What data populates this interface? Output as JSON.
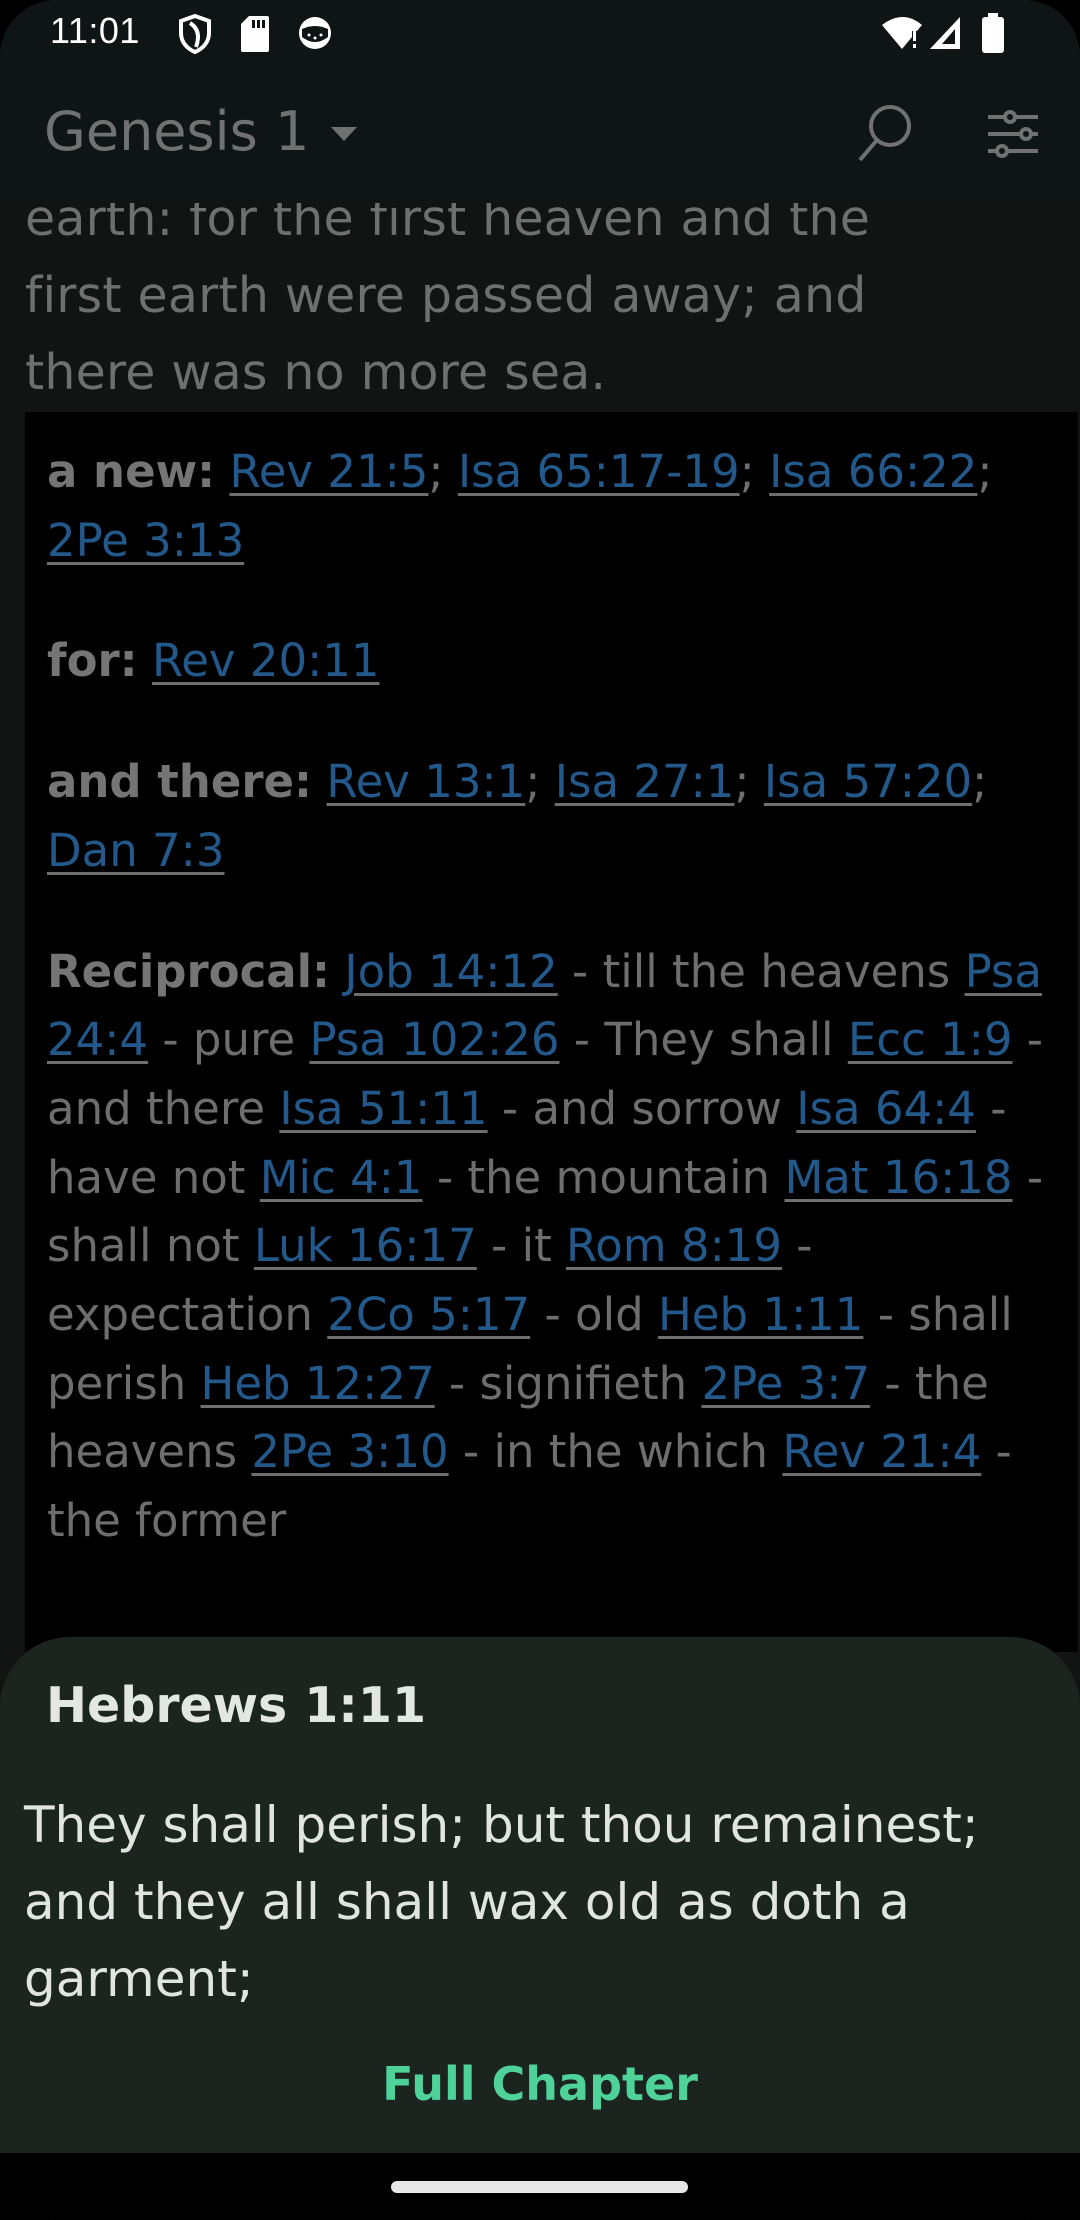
{
  "status_bar": {
    "time": "11:01",
    "left_icons": [
      "shield-icon",
      "sd-card-icon",
      "app-notification-icon"
    ],
    "right_icons": [
      "wifi-alert-icon",
      "cell-signal-icon",
      "battery-icon"
    ]
  },
  "app_bar": {
    "title": "Genesis 1",
    "actions": [
      "search-icon",
      "settings-sliders-icon"
    ]
  },
  "verse_fragment": {
    "lines": [
      "earth: for the first heaven and the",
      "first earth were passed away; and",
      "there was no more sea."
    ]
  },
  "cross_references": [
    {
      "label": "a new:",
      "items": [
        {
          "ref": "Rev 21:5",
          "sep": "; "
        },
        {
          "ref": "Isa 65:17-19",
          "sep": "; "
        },
        {
          "ref": "Isa 66:22",
          "sep": "; "
        },
        {
          "ref": "2Pe 3:13",
          "sep": ""
        }
      ]
    },
    {
      "label": "for:",
      "items": [
        {
          "ref": "Rev 20:11",
          "sep": ""
        }
      ]
    },
    {
      "label": "and there:",
      "items": [
        {
          "ref": "Rev 13:1",
          "sep": "; "
        },
        {
          "ref": "Isa 27:1",
          "sep": "; "
        },
        {
          "ref": "Isa 57:20",
          "sep": "; "
        },
        {
          "ref": "Dan 7:3",
          "sep": ""
        }
      ]
    },
    {
      "label": "Reciprocal:",
      "items": [
        {
          "ref": "Job 14:12",
          "sep": " - till the heavens "
        },
        {
          "ref": "Psa 24:4",
          "sep": " - pure "
        },
        {
          "ref": "Psa 102:26",
          "sep": " - They shall "
        },
        {
          "ref": "Ecc 1:9",
          "sep": " - and there "
        },
        {
          "ref": "Isa 51:11",
          "sep": " - and sorrow "
        },
        {
          "ref": "Isa 64:4",
          "sep": " - have not "
        },
        {
          "ref": "Mic 4:1",
          "sep": " - the mountain "
        },
        {
          "ref": "Mat 16:18",
          "sep": " - shall not "
        },
        {
          "ref": "Luk 16:17",
          "sep": " - it "
        },
        {
          "ref": "Rom 8:19",
          "sep": " - expectation "
        },
        {
          "ref": "2Co 5:17",
          "sep": " - old "
        },
        {
          "ref": "Heb 1:11",
          "sep": " - shall perish "
        },
        {
          "ref": "Heb 12:27",
          "sep": " - signifieth "
        },
        {
          "ref": "2Pe 3:7",
          "sep": " - the heavens "
        },
        {
          "ref": "2Pe 3:10",
          "sep": " - in the which "
        },
        {
          "ref": "Rev 21:4",
          "sep": " - the former"
        }
      ]
    }
  ],
  "popup": {
    "title": "Hebrews 1:11",
    "verse": "They shall perish; but thou remainest; and they all shall wax old as doth a garment;",
    "button_label": "Full Chapter"
  },
  "colors": {
    "link": "#22588a",
    "accent": "#4fd19a",
    "sheet_background": "#1c2420"
  }
}
